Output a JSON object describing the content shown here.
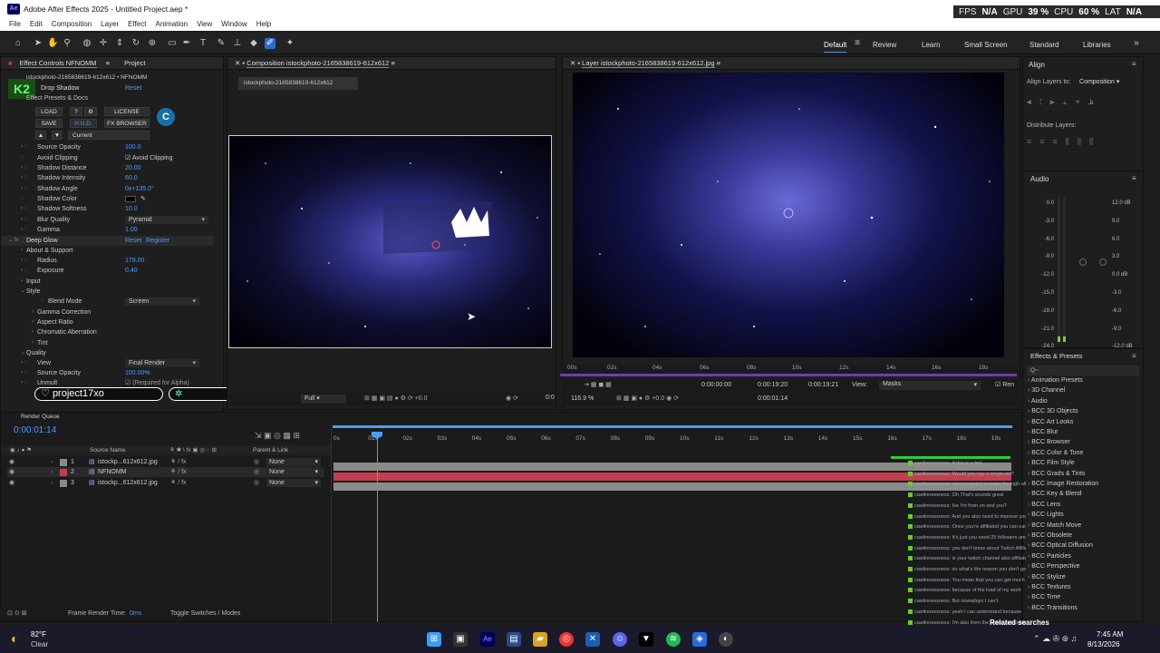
{
  "app": {
    "title": "Adobe After Effects 2025 - Untitled Project.aep *",
    "icon": "ae-icon"
  },
  "perf": {
    "fps_label": "FPS",
    "fps": "N/A",
    "gpu_label": "GPU",
    "gpu": "39 %",
    "cpu_label": "CPU",
    "cpu": "60 %",
    "lat_label": "LAT",
    "lat": "N/A"
  },
  "menu": [
    "File",
    "Edit",
    "Composition",
    "Layer",
    "Effect",
    "Animation",
    "View",
    "Window",
    "Help"
  ],
  "workspaces": [
    "Default",
    "Review",
    "Learn",
    "Small Screen",
    "Standard",
    "Libraries"
  ],
  "effect_panel": {
    "tab1": "Effect Controls NFNOMM",
    "tab2": "Project",
    "layer_path": "istockphoto-2165838619-612x612 • NFNOMM",
    "drop_shadow": "Drop Shadow",
    "reset": "Reset",
    "presets": "Effect Presets & Docs",
    "buttons": [
      "LOAD",
      "?",
      "LICENSE",
      "SAVE",
      "H.U.D.",
      "FX BROWSER"
    ],
    "current": "Current",
    "rows": [
      {
        "label": "Source Opacity",
        "value": "100.0"
      },
      {
        "label": "Avoid Clipping",
        "value": "Avoid Clipping"
      },
      {
        "label": "Shadow Distance",
        "value": "20.00"
      },
      {
        "label": "Shadow Intensity",
        "value": "60.0"
      },
      {
        "label": "Shadow Angle",
        "value": "0x+135.0°"
      },
      {
        "label": "Shadow Color",
        "value": ""
      },
      {
        "label": "Shadow Softness",
        "value": "10.0"
      },
      {
        "label": "Blur Quality",
        "value": "Pyramid"
      },
      {
        "label": "Gamma",
        "value": "1.00"
      }
    ],
    "deep_glow": "Deep Glow",
    "register": "Register",
    "about": "About & Support",
    "radius_label": "Radius",
    "radius": "179.00",
    "exposure_label": "Exposure",
    "exposure": "0.40",
    "input": "Input",
    "style": "Style",
    "blend_label": "Blend Mode",
    "blend": "Screen",
    "gamma_corr": "Gamma Correction",
    "aspect": "Aspect Ratio",
    "chromatic": "Chromatic Aberration",
    "tint": "Tint",
    "quality": "Quality",
    "view_label": "View",
    "view": "Final Render",
    "src_op_label": "Source Opacity",
    "src_op": "100.00%",
    "unmult": "Unmult",
    "required": "(Required for Alpha)"
  },
  "overlay": {
    "username": "project17xo"
  },
  "comp": {
    "tab": "Composition istockphoto-2165838619-612x612",
    "crumb": "istockphoto-2165838619-612x612",
    "zoom": "Full",
    "time": "0:0"
  },
  "layer": {
    "tab": "Layer istockphoto-2165838619-612x612.jpg",
    "zoom": "116.9 %",
    "in": "0:00:00:00",
    "out": "0:00:19:20",
    "dur": "0:00:19:21",
    "view_label": "View:",
    "view": "Masks",
    "t2": "0:00:01:14",
    "render": "Ren",
    "ticks": [
      "00s",
      "02s",
      "04s",
      "06s",
      "08s",
      "10s",
      "12s",
      "14s",
      "16s",
      "18s"
    ]
  },
  "align": {
    "title": "Align",
    "layers_to": "Align Layers to:",
    "target": "Composition",
    "distribute": "Distribute Layers:"
  },
  "audio": {
    "title": "Audio",
    "left": [
      "0.0",
      "-3.0",
      "-6.0",
      "-9.0",
      "-12.0",
      "-15.0",
      "-18.0",
      "-21.0",
      "-24.0"
    ],
    "right": [
      "12.0 dB",
      "9.0",
      "6.0",
      "3.0",
      "0.0 dB",
      "-3.0",
      "-6.0",
      "-9.0",
      "-12.0 dB"
    ]
  },
  "effects": {
    "title": "Effects & Presets",
    "search": "Q~",
    "items": [
      "Animation Presets",
      "3D Channel",
      "Audio",
      "BCC 3D Objects",
      "BCC Art Looks",
      "BCC Blur",
      "BCC Browser",
      "BCC Color & Tone",
      "BCC Film Style",
      "BCC Grads & Tints",
      "BCC Image Restoration",
      "BCC Key & Blend",
      "BCC Lens",
      "BCC Lights",
      "BCC Match Move",
      "BCC Obsolete",
      "BCC Optical Diffusion",
      "BCC Particles",
      "BCC Perspective",
      "BCC Stylize",
      "BCC Textures",
      "BCC Time",
      "BCC Transitions"
    ]
  },
  "timeline": {
    "tab": "Render Queue",
    "timecode": "0:00:01:14",
    "headers": [
      "Source Name",
      "Parent & Link"
    ],
    "layers": [
      {
        "num": "1",
        "name": "istockp...612x612.jpg",
        "parent": "None"
      },
      {
        "num": "2",
        "name": "NFNOMM",
        "parent": "None"
      },
      {
        "num": "3",
        "name": "istockp...612x612.jpg",
        "parent": "None"
      }
    ],
    "ticks": [
      "0s",
      "01s",
      "02s",
      "03s",
      "04s",
      "05s",
      "06s",
      "07s",
      "08s",
      "09s",
      "10s",
      "11s",
      "12s",
      "13s",
      "14s",
      "15s",
      "16s",
      "17s",
      "18s",
      "19s"
    ],
    "frame_render": "Frame Render Time:",
    "frame_render_val": "0ms",
    "toggle": "Toggle Switches / Modes"
  },
  "chat": [
    "cawlinnessness: tf this is a bet",
    "cawlinnessness: Would you say a single vid?",
    "cawlinnessness: are you going to make through all",
    "cawlinnessness: Oh That's sounds great",
    "cawlinnessness: Ive I'm from on and you?",
    "cawlinnessness: And you also need to improve your channel",
    "cawlinnessness: Once you're affiliated you can earn money",
    "cawlinnessness: It's just you need 25 followers and",
    "cawlinnessness: you don't know about Twitch Affiliate",
    "cawlinnessness: is your twitch channel also affiliated",
    "cawlinnessness: so what's the reason you don't get",
    "cawlinnessness: You mean that you can get much more",
    "cawlinnessness: because of the load of my work",
    "cawlinnessness: But nowadays I can't",
    "cawlinnessness: yeah I can understand because",
    "cawlinnessness: I'm also from the indian subcontinent",
    "cawlinnessness: It comes from the uk",
    "cawlinnessness: wow"
  ],
  "related": "Related searches",
  "taskbar": {
    "temp": "82°F",
    "weather": "Clear",
    "time": "7:45 AM",
    "date": "8/13/2026"
  }
}
